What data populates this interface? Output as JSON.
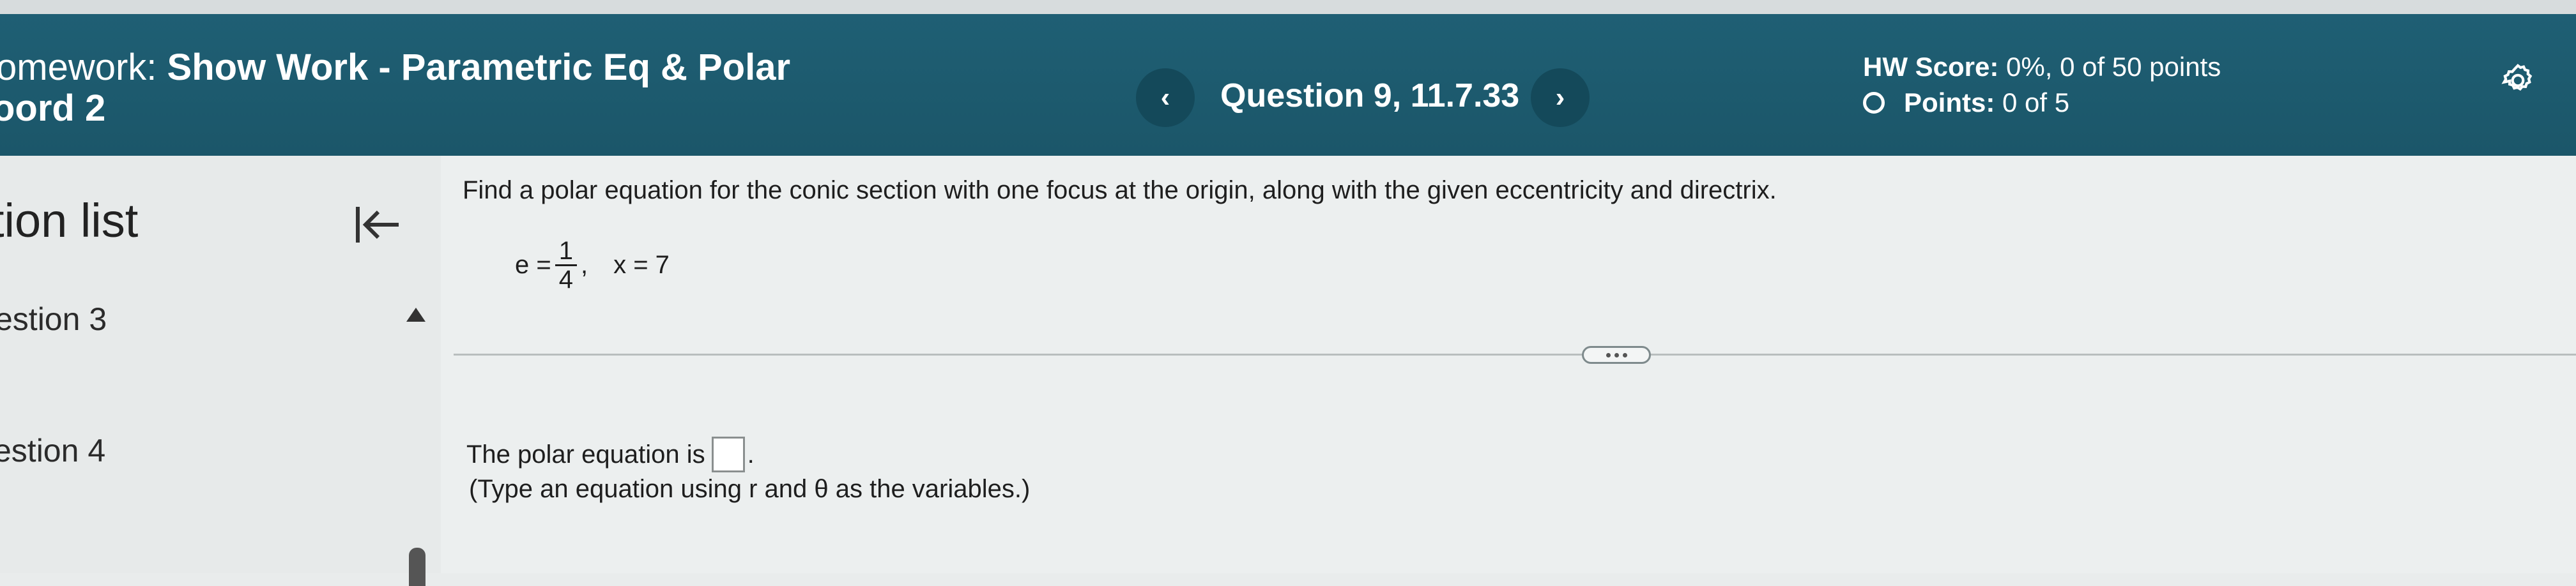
{
  "header": {
    "title_prefix": "omework:",
    "title_main": "Show Work - Parametric Eq & Polar",
    "title_line2": "oord 2",
    "question_label": "Question 9, 11.7.33",
    "prev_glyph": "‹",
    "next_glyph": "›",
    "hw_score_label": "HW Score:",
    "hw_score_value": "0%, 0 of 50 points",
    "points_label": "Points:",
    "points_value": "0 of 5",
    "settings_icon": "gear-icon"
  },
  "sidebar": {
    "title": "tion list",
    "collapse_icon": "collapse-left-icon",
    "items": [
      {
        "label": "estion 3"
      },
      {
        "label": "estion 4"
      }
    ]
  },
  "problem": {
    "instruction": "Find a polar equation for the conic section with one focus at the origin, along with the given eccentricity and directrix.",
    "e_label": "e =",
    "e_numerator": "1",
    "e_denominator": "4",
    "separator": ",",
    "directrix": "x = 7",
    "answer_prompt": "The polar equation is",
    "answer_value": "",
    "answer_suffix": ".",
    "hint": "(Type an equation using r and θ as the variables.)"
  },
  "colors": {
    "header_bg": "#1f5f74",
    "nav_button_bg": "#14495a",
    "content_bg": "#ecefef"
  }
}
